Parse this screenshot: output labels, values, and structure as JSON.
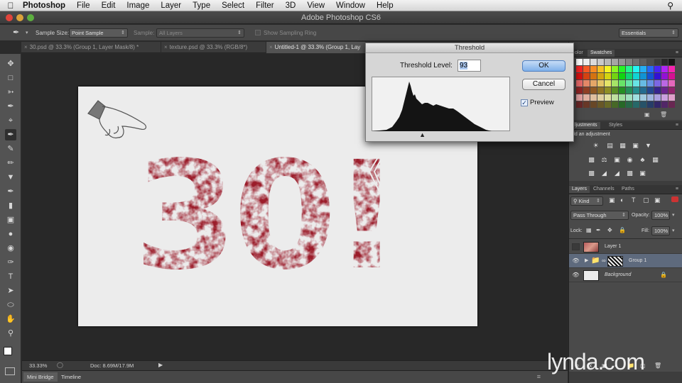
{
  "menubar": {
    "app": "Photoshop",
    "items": [
      "File",
      "Edit",
      "Image",
      "Layer",
      "Type",
      "Select",
      "Filter",
      "3D",
      "View",
      "Window",
      "Help"
    ]
  },
  "window": {
    "title": "Adobe Photoshop CS6"
  },
  "options": {
    "sample_size_label": "Sample Size:",
    "sample_size_value": "Point Sample",
    "sample_label": "Sample:",
    "sample_value": "All Layers",
    "sampling_ring_label": "Show Sampling Ring",
    "workspace_value": "Essentials"
  },
  "tabs": [
    {
      "label": "30.psd @ 33.3% (Group 1, Layer Mask/8) *",
      "active": false
    },
    {
      "label": "texture.psd @ 33.3% (RGB/8*)",
      "active": false
    },
    {
      "label": "Untitled-1 @ 33.3% (Group 1, Lay",
      "active": true
    }
  ],
  "status": {
    "zoom": "33.33%",
    "doc": "Doc: 8.69M/17.9M"
  },
  "bottom_tabs": [
    "Mini Bridge",
    "Timeline"
  ],
  "panels": {
    "color_tab": "olor",
    "swatches_tab": "Swatches",
    "adjustments_tab": "ljustments",
    "styles_tab": "Styles",
    "add_adjustment": "dd an adjustment",
    "layers_tab": "Layers",
    "channels_tab": "Channels",
    "paths_tab": "Paths",
    "kind_filter": "Kind",
    "blend_mode": "Pass Through",
    "opacity_label": "Opacity:",
    "opacity_value": "100%",
    "lock_label": "Lock:",
    "fill_label": "Fill:",
    "fill_value": "100%",
    "layers": [
      {
        "name": "Layer 1",
        "visible": false,
        "selected": false
      },
      {
        "name": "Group 1",
        "visible": true,
        "selected": true
      },
      {
        "name": "Background",
        "visible": true,
        "selected": false,
        "locked": true
      }
    ]
  },
  "dialog": {
    "title": "Threshold",
    "level_label": "Threshold Level:",
    "level_value": "93",
    "ok_label": "OK",
    "cancel_label": "Cancel",
    "preview_label": "Preview",
    "preview_checked": true,
    "slider_level": 93
  },
  "canvas": {
    "artwork_text": "30!",
    "artwork_color": "#9b1c2a"
  },
  "watermark": "lynda.com"
}
